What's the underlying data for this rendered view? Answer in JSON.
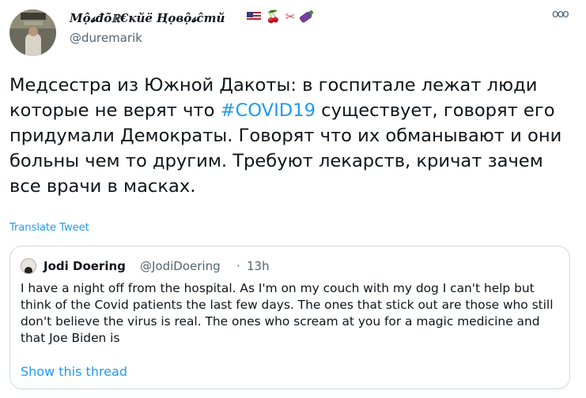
{
  "tweet": {
    "display_name": "Мộ𝓼đõℝ€кйё Ңọвộ𝓼ĉтй",
    "emojis": [
      "us-flag-icon",
      "cherries-icon",
      "scissors-icon",
      "eggplant-icon"
    ],
    "cherry_glyph": "🍒",
    "scissors_glyph": "✂",
    "handle": "@duremarik",
    "more_glyph": "ooo",
    "body_before": "Медсестра из Южной Дакоты: в госпитале лежат люди которые не верят что ",
    "hashtag": "#COVID19",
    "body_after": " существует, говорят его придумали Демократы. Говорят что их обманывают и они больны чем то другим. Требуют лекарств, кричат зачем все врачи в масках.",
    "translate_label": "Translate Tweet"
  },
  "quote": {
    "name": "Jodi Doering",
    "handle": "@JodiDoering",
    "dot": "·",
    "time": "13h",
    "text": "I have a night off from the hospital. As I'm on my couch with my dog I can't help but think of the Covid patients the last few days. The ones that stick out are those who still don't believe the virus is real. The ones who scream at you for a magic medicine and that Joe Biden is",
    "show_thread_label": "Show this thread"
  },
  "colors": {
    "link": "#1d9bf0",
    "secondary_text": "#536471",
    "primary_text": "#0f1419",
    "border": "#cfd9de"
  }
}
